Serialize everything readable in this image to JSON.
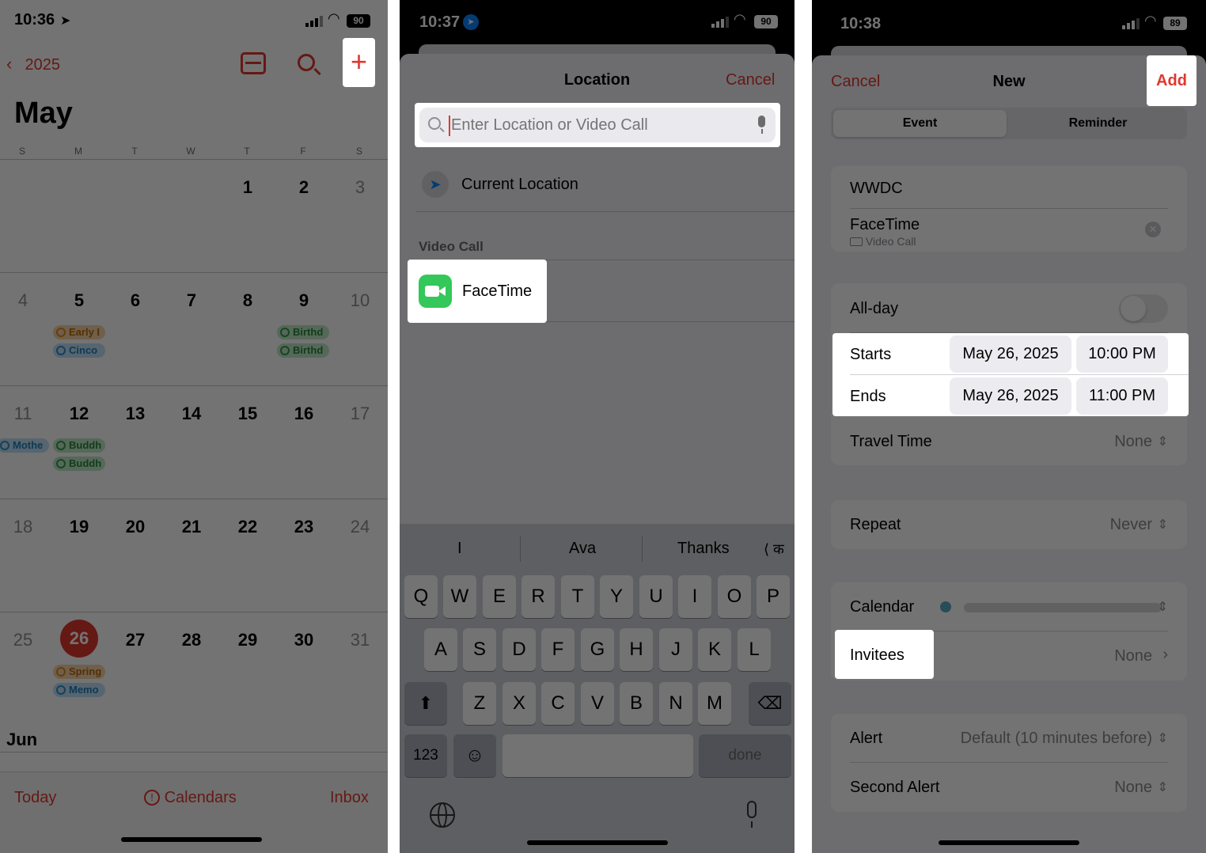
{
  "phone1": {
    "status": {
      "time": "10:36",
      "battery": "90"
    },
    "nav": {
      "back_label": "2025"
    },
    "month_title": "May",
    "weekdays": [
      "S",
      "M",
      "T",
      "W",
      "T",
      "F",
      "S"
    ],
    "weeks": [
      [
        "",
        "",
        "",
        "",
        "1",
        "2",
        "3"
      ],
      [
        "4",
        "5",
        "6",
        "7",
        "8",
        "9",
        "10"
      ],
      [
        "11",
        "12",
        "13",
        "14",
        "15",
        "16",
        "17"
      ],
      [
        "18",
        "19",
        "20",
        "21",
        "22",
        "23",
        "24"
      ],
      [
        "25",
        "26",
        "27",
        "28",
        "29",
        "30",
        "31"
      ]
    ],
    "events": {
      "w2_mon_1": "Early I",
      "w2_mon_2": "Cinco",
      "w2_fri_1": "Birthd",
      "w2_fri_2": "Birthd",
      "w3_sun": "Mothe",
      "w3_mon_1": "Buddh",
      "w3_mon_2": "Buddh",
      "w5_mon_1": "Spring",
      "w5_mon_2": "Memo"
    },
    "next_month": "Jun",
    "tabbar": {
      "today": "Today",
      "calendars": "Calendars",
      "inbox": "Inbox"
    },
    "colors": {
      "accent": "#e0382e"
    }
  },
  "phone2": {
    "status": {
      "time": "10:37",
      "battery": "90"
    },
    "header": {
      "title": "Location",
      "cancel": "Cancel"
    },
    "search": {
      "placeholder": "Enter Location or Video Call"
    },
    "current_location": "Current Location",
    "section_video": "Video Call",
    "facetime": "FaceTime",
    "suggestions": [
      "I",
      "Ava",
      "Thanks",
      "क"
    ],
    "keys": {
      "row1": [
        "Q",
        "W",
        "E",
        "R",
        "T",
        "Y",
        "U",
        "I",
        "O",
        "P"
      ],
      "row2": [
        "A",
        "S",
        "D",
        "F",
        "G",
        "H",
        "J",
        "K",
        "L"
      ],
      "row3": [
        "Z",
        "X",
        "C",
        "V",
        "B",
        "N",
        "M"
      ],
      "numbers": "123",
      "done": "done"
    },
    "colors": {
      "facetime_green": "#34c759"
    }
  },
  "phone3": {
    "status": {
      "time": "10:38",
      "battery": "89"
    },
    "header": {
      "cancel": "Cancel",
      "title": "New",
      "add": "Add"
    },
    "segments": {
      "event": "Event",
      "reminder": "Reminder"
    },
    "title_value": "WWDC",
    "location": {
      "name": "FaceTime",
      "sub": "Video Call"
    },
    "allday_label": "All-day",
    "starts": {
      "label": "Starts",
      "date": "May 26, 2025",
      "time": "10:00 PM"
    },
    "ends": {
      "label": "Ends",
      "date": "May 26, 2025",
      "time": "11:00 PM"
    },
    "travel": {
      "label": "Travel Time",
      "value": "None"
    },
    "repeat": {
      "label": "Repeat",
      "value": "Never"
    },
    "calendar_label": "Calendar",
    "invitees": {
      "label": "Invitees",
      "value": "None"
    },
    "alert": {
      "label": "Alert",
      "value": "Default (10 minutes before)"
    },
    "second_alert": {
      "label": "Second Alert",
      "value": "None"
    }
  }
}
